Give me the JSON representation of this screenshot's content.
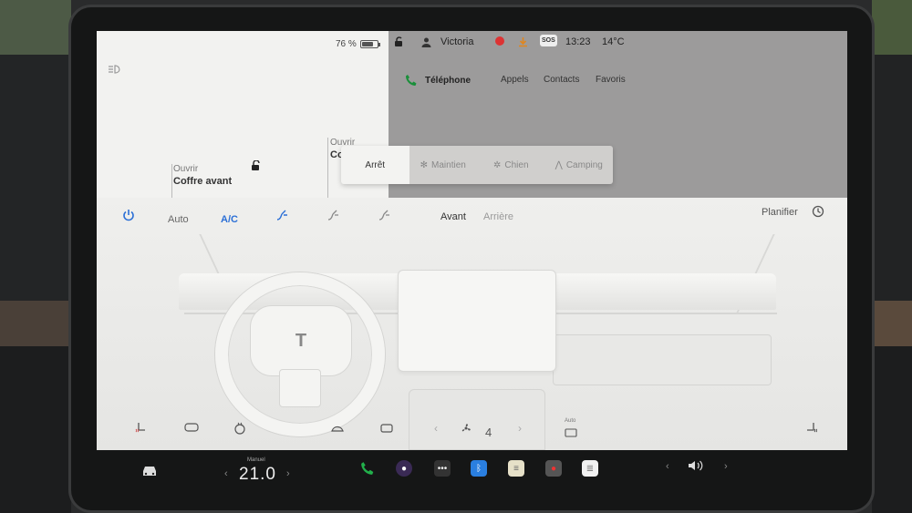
{
  "status": {
    "battery_percent": "76 %",
    "battery_level": 0.76,
    "user": "Victoria",
    "time": "13:23",
    "temperature": "14°C",
    "sos": "SOS"
  },
  "vehicle": {
    "front_trunk_action": "Ouvrir",
    "front_trunk_label": "Coffre avant",
    "rear_trunk_action": "Ouvrir",
    "rear_trunk_label": "Co"
  },
  "phone": {
    "title": "Téléphone",
    "tabs": [
      "Appels",
      "Contacts",
      "Favoris"
    ]
  },
  "modes": {
    "items": [
      "Arrêt",
      "Maintien",
      "Chien",
      "Camping"
    ],
    "selected": "Arrêt"
  },
  "climate": {
    "auto_label": "Auto",
    "ac_label": "A/C",
    "front_label": "Avant",
    "rear_label": "Arrière",
    "schedule_label": "Planifier",
    "fan_speed": "4",
    "auto_mini": "Auto"
  },
  "dock": {
    "temp_mode": "Manuel",
    "temp_value": "21.0"
  },
  "colors": {
    "accent_blue": "#2b6fd6",
    "phone_green": "#1a8f3a",
    "record_red": "#d33333"
  },
  "icons": [
    "car-icon",
    "phone-icon",
    "camera-icon",
    "more-icon",
    "bluetooth-icon",
    "notes-icon",
    "dashcam-icon",
    "calendar-icon",
    "volume-icon",
    "lock-icon",
    "power-icon",
    "fan-icon",
    "schedule-icon"
  ]
}
